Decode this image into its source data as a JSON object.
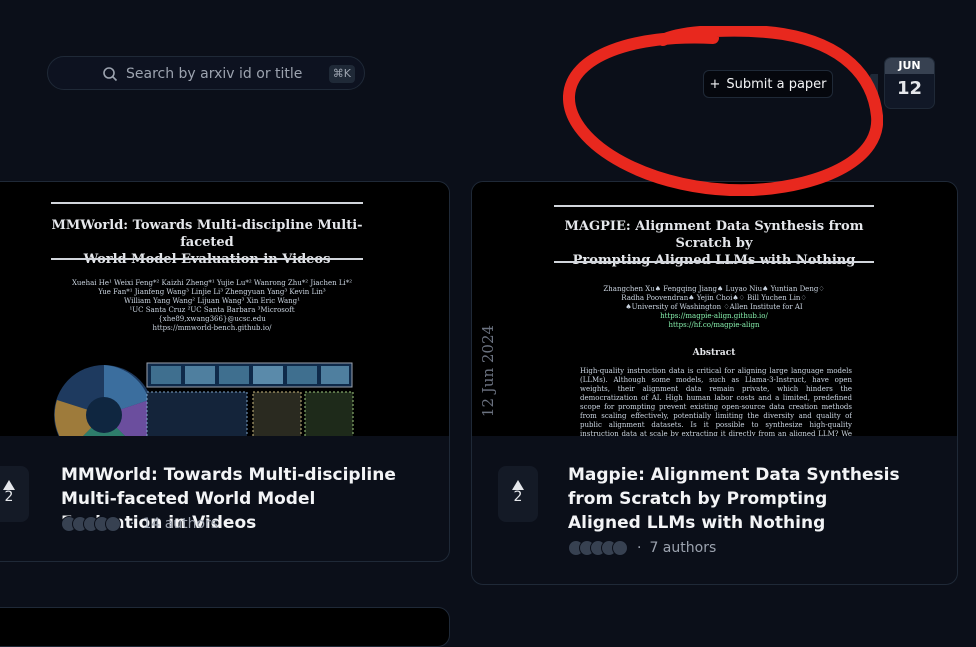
{
  "search": {
    "placeholder": "Search by arxiv id or title",
    "shortcut": "⌘K"
  },
  "submit": {
    "label": "Submit a paper"
  },
  "date_badge": {
    "month": "JUN",
    "day": "12"
  },
  "cards": [
    {
      "thumbnail": {
        "title_lines": [
          "MMWorld: Towards Multi-discipline Multi-faceted",
          "World Model Evaluation in Videos"
        ],
        "authors_lines": [
          "Xuehai He¹ Weixi Feng*² Kaizhi Zheng*¹ Yujie Lu*² Wanrong Zhu*² Jiachen Li*²",
          "Yue Fan*¹ Jianfeng Wang³ Linjie Li³ Zhengyuan Yang³ Kevin Lin³",
          "William Yang Wang² Lijuan Wang³ Xin Eric Wang¹",
          "¹UC Santa Cruz ²UC Santa Barbara ³Microsoft",
          "{xhe89,xwang366}@ucsc.edu",
          "https://mmworld-bench.github.io/"
        ]
      },
      "votes": "2",
      "title": "MMWorld: Towards Multi-discipline Multi-faceted World Model Evaluation in Videos",
      "authors": "14 authors"
    },
    {
      "thumbnail": {
        "title_lines": [
          "MAGPIE: Alignment Data Synthesis from Scratch by",
          "Prompting Aligned LLMs with Nothing"
        ],
        "authors_lines": [
          "Zhangchen Xu♠ Fengqing Jiang♠ Luyao Niu♠ Yuntian Deng♢",
          "Radha Poovendran♠ Yejin Choi♠♢ Bill Yuchen Lin♢",
          "♠University of Washington ♢Allen Institute for AI",
          "https://magpie-align.github.io/",
          "https://hf.co/magpie-align"
        ],
        "abstract_heading": "Abstract",
        "abstract_text": "High-quality instruction data is critical for aligning large language models (LLMs). Although some models, such as Llama-3-Instruct, have open weights, their alignment data remain private, which hinders the democratization of AI. High human labor costs and a limited, predefined scope for prompting prevent existing open-source data creation methods from scaling effectively, potentially limiting the diversity and quality of public alignment datasets. Is it possible to synthesize high-quality instruction data at scale by extracting it directly from an aligned LLM? We present a self-synthesis method for generating large-scale alignment data",
        "side_date": "12 Jun 2024"
      },
      "votes": "2",
      "title_lines": [
        "Magpie: Alignment Data Synthesis",
        "from Scratch by Prompting",
        "Aligned LLMs with Nothing"
      ],
      "authors": "7 authors"
    }
  ],
  "colors": {
    "background": "#0b0f19",
    "annotation": "#e8281e",
    "badge_month": "#374151"
  }
}
